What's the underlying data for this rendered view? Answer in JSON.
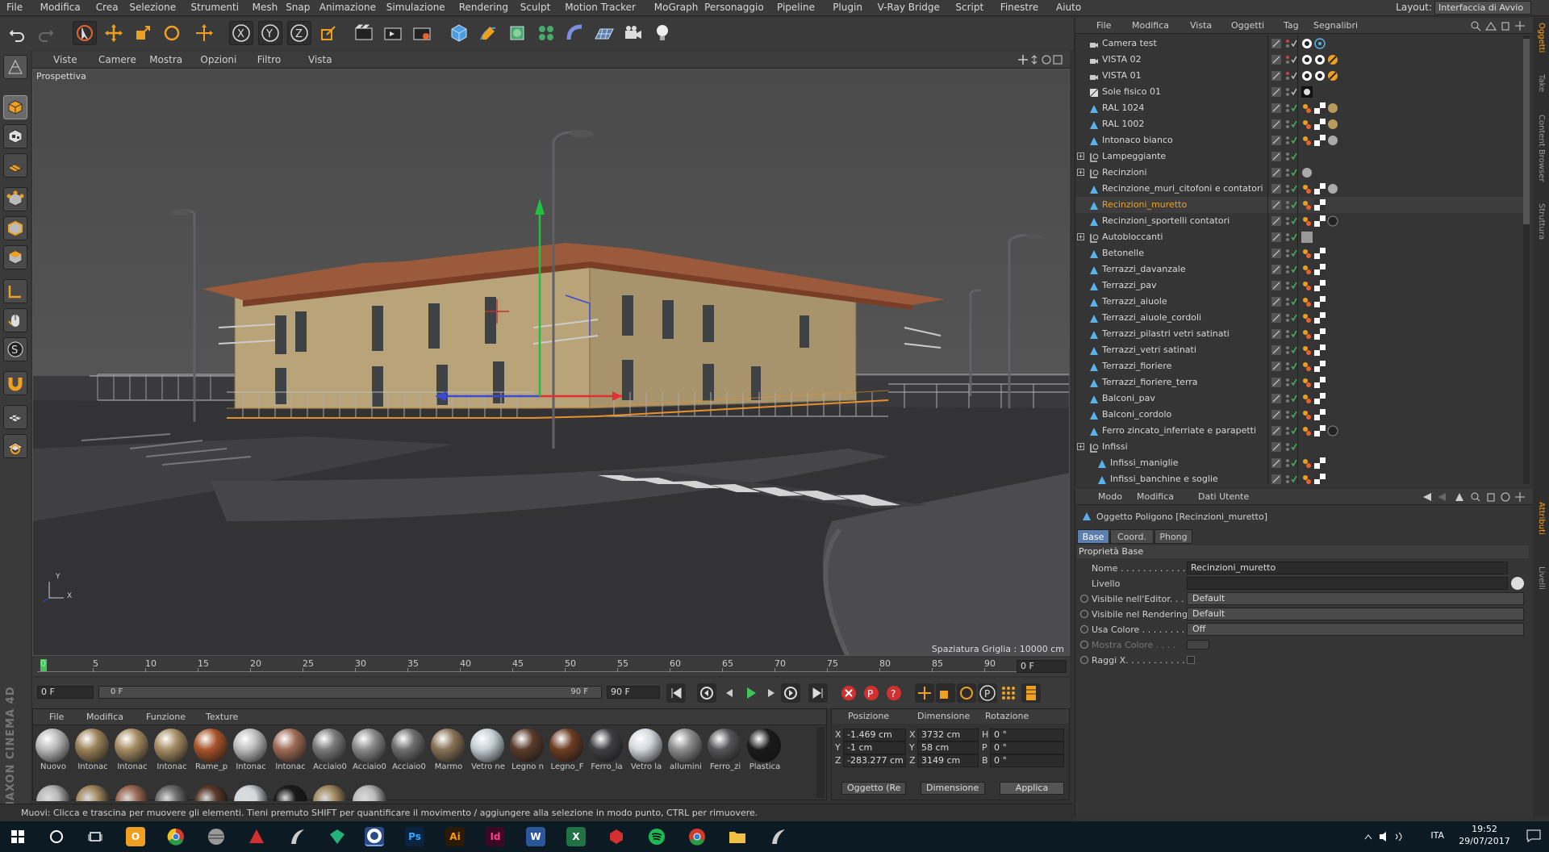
{
  "menubar": {
    "items": [
      "File",
      "Modifica",
      "Crea",
      "Selezione",
      "Strumenti",
      "Mesh",
      "Snap",
      "Animazione",
      "Simulazione",
      "Rendering",
      "Sculpt",
      "Motion Tracker",
      "MoGraph",
      "Personaggio",
      "Pipeline",
      "Plugin",
      "V-Ray Bridge",
      "Script",
      "Finestre",
      "Aiuto"
    ],
    "layout_label": "Layout:",
    "layout_value": "Interfaccia di Avvio"
  },
  "viewport": {
    "menu": [
      "Viste",
      "Camere",
      "Mostra",
      "Opzioni",
      "Filtro",
      "Vista"
    ],
    "view_name": "Prospettiva",
    "grid_spacing": "Spaziatura Griglia : 10000 cm",
    "axis_x": "X",
    "axis_y": "Y"
  },
  "timeline": {
    "ticks": [
      "0",
      "5",
      "10",
      "15",
      "20",
      "25",
      "30",
      "35",
      "40",
      "45",
      "50",
      "55",
      "60",
      "65",
      "70",
      "75",
      "80",
      "85",
      "90"
    ],
    "frame_right": "0 F"
  },
  "transport": {
    "start": "0 F",
    "slider_left": "0 F",
    "slider_right": "90 F",
    "end": "90 F"
  },
  "materials": {
    "menu": [
      "File",
      "Modifica",
      "Funzione",
      "Texture"
    ],
    "items": [
      {
        "name": "Nuovo",
        "color": "#b9b9b9"
      },
      {
        "name": "Intonac",
        "color": "#9b8157"
      },
      {
        "name": "Intonac",
        "color": "#a48c62"
      },
      {
        "name": "Intonac",
        "color": "#a58c63"
      },
      {
        "name": "Rame_p",
        "color": "#a8542a"
      },
      {
        "name": "Intonac",
        "color": "#bdbdbd"
      },
      {
        "name": "Intonac",
        "color": "#9e6a55"
      },
      {
        "name": "Acciaio0",
        "color": "#7a7a7a"
      },
      {
        "name": "Acciaio0",
        "color": "#8a8a8a"
      },
      {
        "name": "Acciaio0",
        "color": "#6e6e6e"
      },
      {
        "name": "Marmo",
        "color": "#877257"
      },
      {
        "name": "Vetro ne",
        "color": "#c4cfd6"
      },
      {
        "name": "Legno n",
        "color": "#5a3b2b"
      },
      {
        "name": "Legno_F",
        "color": "#6d3c22"
      },
      {
        "name": "Ferro_la",
        "color": "#3f3f43"
      },
      {
        "name": "Vetro la",
        "color": "#d2d8dd"
      },
      {
        "name": "allumini",
        "color": "#8d8d8d"
      },
      {
        "name": "Ferro_zi",
        "color": "#555557"
      },
      {
        "name": "Plastica",
        "color": "#1a1a1a"
      }
    ]
  },
  "coords": {
    "headers": [
      "Posizione",
      "Dimensione",
      "Rotazione"
    ],
    "rows": [
      {
        "a": "X",
        "pos": "-1.469 cm",
        "d": "X",
        "dim": "3732 cm",
        "r": "H",
        "rot": "0 °"
      },
      {
        "a": "Y",
        "pos": "-1 cm",
        "d": "Y",
        "dim": "58 cm",
        "r": "P",
        "rot": "0 °"
      },
      {
        "a": "Z",
        "pos": "-283.277 cm",
        "d": "Z",
        "dim": "3149 cm",
        "r": "B",
        "rot": "0 °"
      }
    ],
    "mode_select": "Oggetto (Re",
    "dim_select": "Dimensione",
    "apply": "Applica"
  },
  "status": "Muovi: Clicca e trascina per muovere gli elementi. Tieni premuto SHIFT per quantificare il movimento / aggiungere alla selezione in modo punto, CTRL per rimuovere.",
  "objects": {
    "menu": [
      "File",
      "Modifica",
      "Vista",
      "Oggetti",
      "Tag",
      "Segnalibri"
    ],
    "items": [
      {
        "name": "Camera test",
        "type": "camera"
      },
      {
        "name": "VISTA 02",
        "type": "camera"
      },
      {
        "name": "VISTA 01",
        "type": "camera"
      },
      {
        "name": "Sole fisico 01",
        "type": "sun"
      },
      {
        "name": "RAL 1024",
        "type": "poly"
      },
      {
        "name": "RAL 1002",
        "type": "poly"
      },
      {
        "name": "Intonaco bianco",
        "type": "poly"
      },
      {
        "name": "Lampeggiante",
        "type": "null",
        "expand": true
      },
      {
        "name": "Recinzioni",
        "type": "null",
        "expand": true
      },
      {
        "name": "Recinzione_muri_citofoni e contatori",
        "type": "poly"
      },
      {
        "name": "Recinzioni_muretto",
        "type": "poly",
        "selected": true
      },
      {
        "name": "Recinzioni_sportelli contatori",
        "type": "poly"
      },
      {
        "name": "Autobloccanti",
        "type": "null",
        "expand": true
      },
      {
        "name": "Betonelle",
        "type": "poly"
      },
      {
        "name": "Terrazzi_davanzale",
        "type": "poly"
      },
      {
        "name": "Terrazzi_pav",
        "type": "poly"
      },
      {
        "name": "Terrazzi_aiuole",
        "type": "poly"
      },
      {
        "name": "Terrazzi_aiuole_cordoli",
        "type": "poly"
      },
      {
        "name": "Terrazzi_pilastri vetri satinati",
        "type": "poly"
      },
      {
        "name": "Terrazzi_vetri satinati",
        "type": "poly"
      },
      {
        "name": "Terrazzi_fioriere",
        "type": "poly"
      },
      {
        "name": "Terrazzi_fioriere_terra",
        "type": "poly"
      },
      {
        "name": "Balconi_pav",
        "type": "poly"
      },
      {
        "name": "Balconi_cordolo",
        "type": "poly"
      },
      {
        "name": "Ferro zincato_inferriate e parapetti",
        "type": "poly"
      },
      {
        "name": "Infissi",
        "type": "null",
        "expand": true
      },
      {
        "name": "Infissi_maniglie",
        "type": "poly",
        "indent": true
      },
      {
        "name": "Infissi_banchine e soglie",
        "type": "poly",
        "indent": true
      }
    ]
  },
  "attributes": {
    "menu": [
      "Modo",
      "Modifica",
      "Dati Utente"
    ],
    "object_title": "Oggetto Poligono [Recinzioni_muretto]",
    "tabs": [
      "Base",
      "Coord.",
      "Phong"
    ],
    "section": "Proprietà Base",
    "fields": [
      {
        "label": "Nome . . . . . . . . . . . . . .",
        "value": "Recinzioni_muretto",
        "kind": "text"
      },
      {
        "label": "Livello",
        "value": "",
        "kind": "text"
      },
      {
        "label": "Visibile nell'Editor. . . .",
        "value": "Default",
        "kind": "select"
      },
      {
        "label": "Visibile nel Rendering",
        "value": "Default",
        "kind": "select"
      },
      {
        "label": "Usa Colore . . . . . . . . .",
        "value": "Off",
        "kind": "select"
      },
      {
        "label": "Mostra Colore . . . .",
        "value": "",
        "kind": "color"
      },
      {
        "label": "Raggi X. . . . . . . . . . . .",
        "value": "",
        "kind": "check"
      }
    ]
  },
  "right_tabs": [
    "Oggetti",
    "Take",
    "Content Browser",
    "Struttura",
    "Attributi",
    "Livelli"
  ],
  "taskbar": {
    "lang": "ITA",
    "time": "19:52",
    "date": "29/07/2017"
  },
  "brand": "MAXON CINEMA 4D"
}
